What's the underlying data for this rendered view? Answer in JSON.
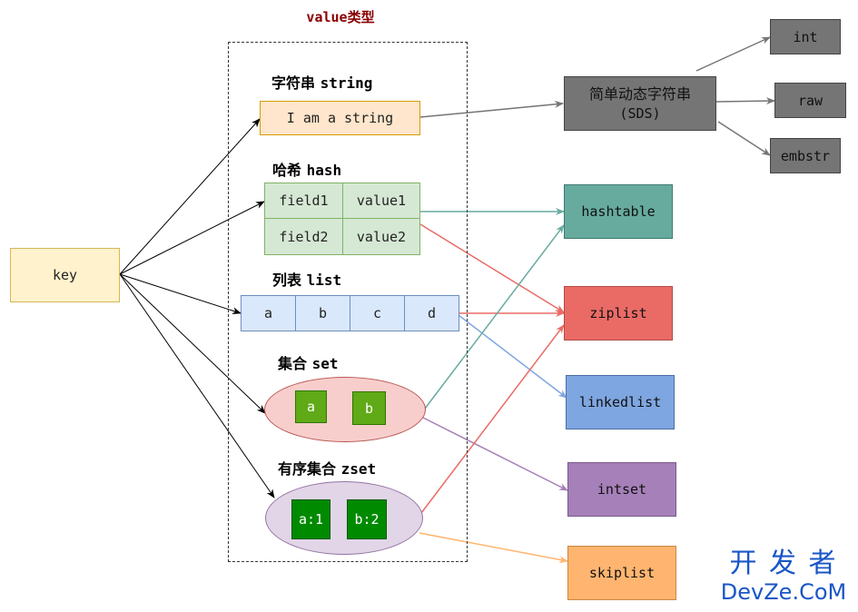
{
  "title": "value类型",
  "key_label": "key",
  "sections": {
    "string": {
      "label_cn": "字符串",
      "label_en": "string",
      "value": "I am a string"
    },
    "hash": {
      "label_cn": "哈希",
      "label_en": "hash",
      "cells": [
        [
          "field1",
          "value1"
        ],
        [
          "field2",
          "value2"
        ]
      ]
    },
    "list": {
      "label_cn": "列表",
      "label_en": "list",
      "items": [
        "a",
        "b",
        "c",
        "d"
      ]
    },
    "set": {
      "label_cn": "集合",
      "label_en": "set",
      "items": [
        "a",
        "b"
      ]
    },
    "zset": {
      "label_cn": "有序集合",
      "label_en": "zset",
      "items": [
        "a:1",
        "b:2"
      ]
    }
  },
  "encodings": {
    "sds": {
      "line1": "简单动态字符串",
      "line2": "(SDS)"
    },
    "int": "int",
    "raw": "raw",
    "embstr": "embstr",
    "hashtable": "hashtable",
    "ziplist": "ziplist",
    "linkedlist": "linkedlist",
    "intset": "intset",
    "skiplist": "skiplist"
  },
  "colors": {
    "key_fill": "#fff2cc",
    "key_stroke": "#d6b656",
    "string_fill": "#ffe6cc",
    "string_stroke": "#d79b00",
    "hash_fill": "#d5e8d4",
    "hash_stroke": "#82b366",
    "list_fill": "#dae8fc",
    "list_stroke": "#6c8ebf",
    "set_fill": "#f8cecc",
    "set_stroke": "#b85450",
    "zset_fill": "#e1d5e7",
    "zset_stroke": "#9673a6",
    "set_item": "#60a917",
    "zset_item": "#008a00",
    "sds_fill": "#757575",
    "gray_fill": "#757575",
    "hashtable_fill": "#67ab9f",
    "ziplist_fill": "#ea6b66",
    "linkedlist_fill": "#7ea6e0",
    "intset_fill": "#a680b8",
    "skiplist_fill": "#ffb570"
  },
  "watermark": {
    "line1": "开 发 者",
    "line2": "DevZe.CoM"
  }
}
